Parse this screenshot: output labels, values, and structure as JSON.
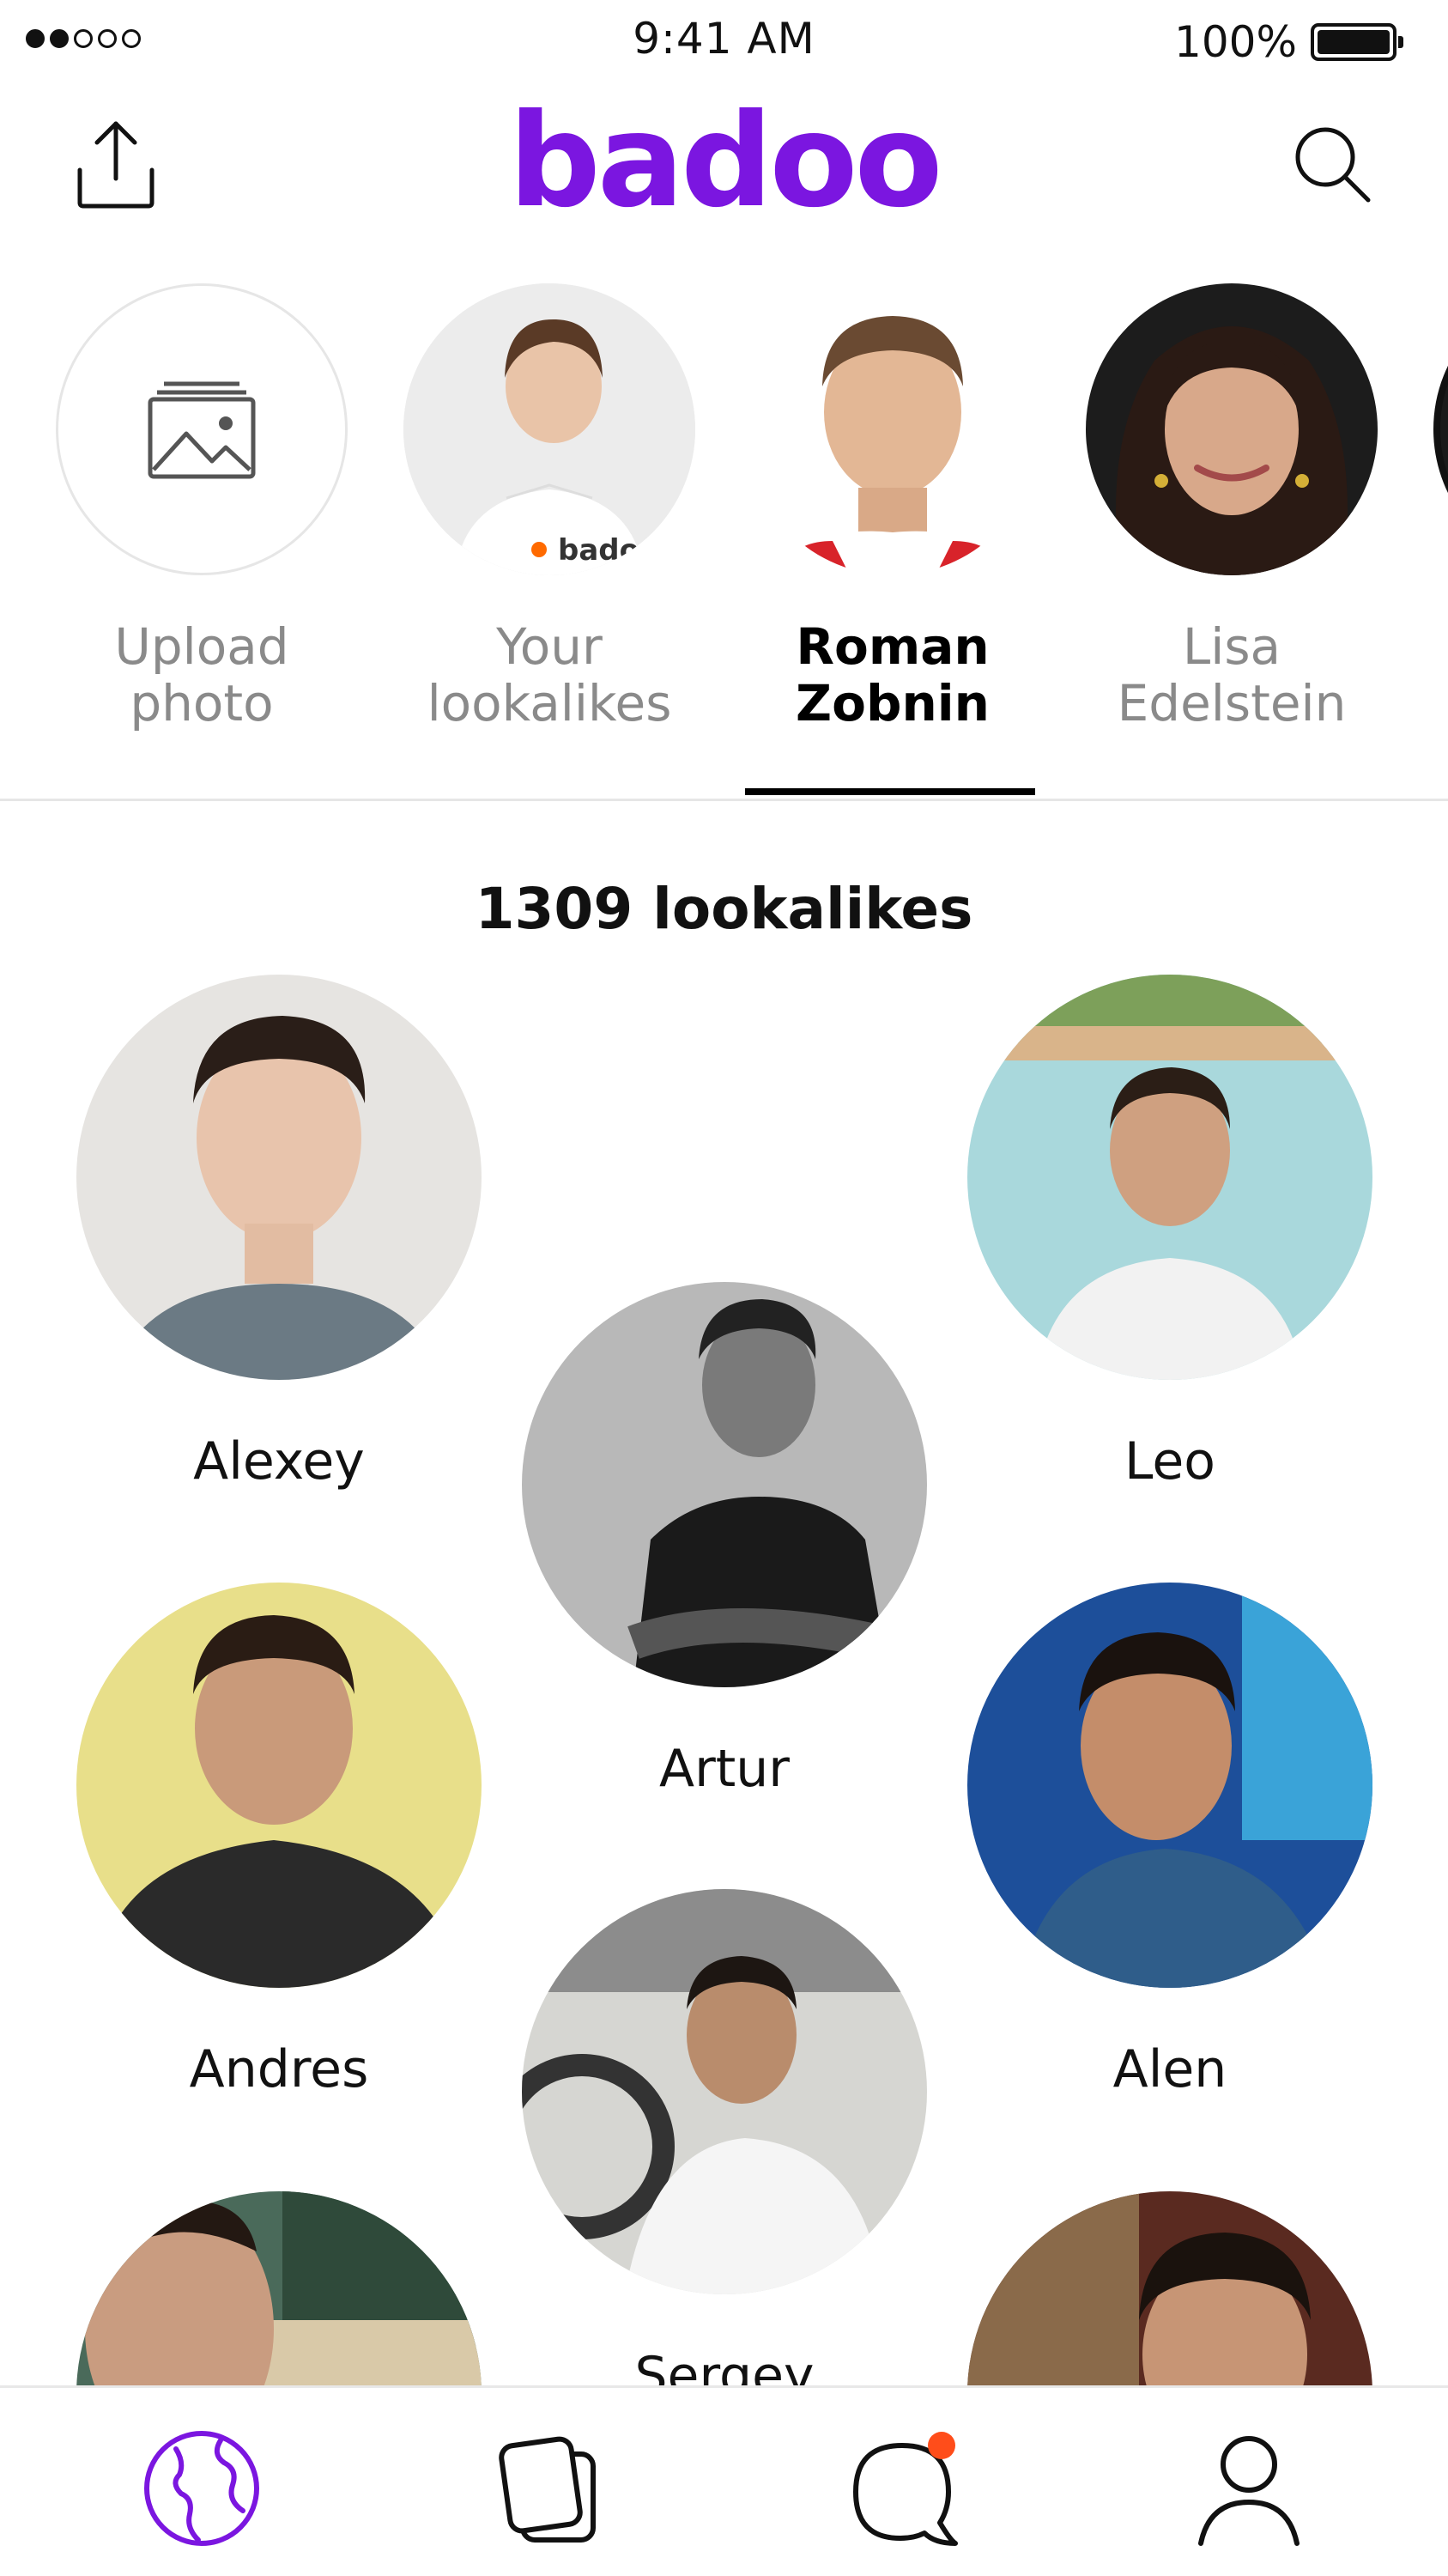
{
  "status_bar": {
    "time": "9:41 AM",
    "battery": "100%",
    "signal_dots": [
      "filled",
      "filled",
      "empty",
      "empty",
      "empty"
    ]
  },
  "header": {
    "logo": "badoo",
    "share_icon": "share-icon",
    "search_icon": "search-icon"
  },
  "stories": [
    {
      "label": "Upload\nphoto",
      "icon": "image-upload-icon",
      "active": false
    },
    {
      "label": "Your\nlookalikes",
      "active": false
    },
    {
      "label": "Roman\nZobnin",
      "active": true
    },
    {
      "label": "Lisa\nEdelstein",
      "active": false
    }
  ],
  "results": {
    "count_label": "1309 lookalikes"
  },
  "people": [
    {
      "name": "Alexey"
    },
    {
      "name": "Artur"
    },
    {
      "name": "Leo"
    },
    {
      "name": "Andres"
    },
    {
      "name": "Sergey"
    },
    {
      "name": "Alen"
    },
    {
      "name": ""
    },
    {
      "name": ""
    }
  ],
  "tabbar": {
    "items": [
      "explore-icon",
      "encounters-icon",
      "chat-icon",
      "profile-icon"
    ],
    "active_color": "#7b16e0",
    "notification_color": "#ff4d1a"
  },
  "colors": {
    "brand": "#7b16e0",
    "text": "#111111",
    "muted": "#8a8a8a"
  }
}
